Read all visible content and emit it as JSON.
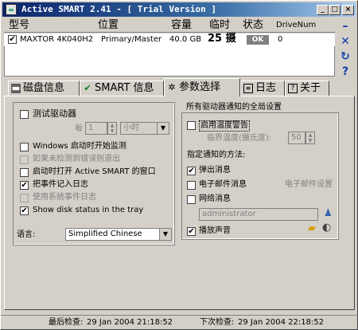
{
  "window": {
    "title": "Active SMART 2.41 - [ Trial Version ]"
  },
  "titlebar_buttons": {
    "minimize": "_",
    "maximize": "□",
    "close": "×"
  },
  "columns": {
    "model": "型号",
    "location": "位置",
    "capacity": "容量",
    "temp": "临时",
    "status": "状态",
    "drivenum": "DriveNum"
  },
  "drive": {
    "checked": "✔",
    "model": "MAXTOR 4K040H2",
    "location": "Primary/Master",
    "capacity": "40.0 GB",
    "temp": "25 摄",
    "status": "OK",
    "drivenum": "0"
  },
  "side_icons": {
    "minimize": "–",
    "close": "✕",
    "refresh": "↻",
    "help": "?"
  },
  "tabs": [
    {
      "label": "磁盘信息",
      "icon": "disk-icon"
    },
    {
      "label": "SMART 信息",
      "icon": "check-icon"
    },
    {
      "label": "参数选择",
      "icon": "gear-icon"
    },
    {
      "label": "日志",
      "icon": "log-icon"
    },
    {
      "label": "关于",
      "icon": "help-icon"
    }
  ],
  "left": {
    "test_drive": "测试驱动器",
    "every": "每",
    "every_value": "1",
    "every_unit": "小时",
    "windows_start": "Windows 启动时开始监测",
    "exit_if_none": "如果未检测到错误则退出",
    "open_window": "启动时打开 Active SMART 的窗口",
    "log_event": "把事件记入日志",
    "use_system_log": "使用系统事件日志",
    "show_tray": "Show disk status in the tray",
    "language_label": "语言:",
    "language_value": "Simplified Chinese",
    "check": "✔"
  },
  "right": {
    "group_title": "所有驱动器通知的全局设置",
    "enable_temp": "启用温度警告",
    "critical_temp": "临界温度(摄氏度):",
    "critical_value": "50",
    "notify_method": "指定通知的方法:",
    "popup": "弹出消息",
    "email": "电子邮件消息",
    "email_settings": "电子邮件设置",
    "net_message": "网络消息",
    "net_user": "administrator",
    "play_sound": "播放声音",
    "check": "✔"
  },
  "status": {
    "last_label": "最后检查:",
    "last_value": "29 Jan 2004  21:18:52",
    "next_label": "下次检查:",
    "next_value": "29 Jan 2004  22:18:52"
  },
  "colors": {
    "title_start": "#0a246a",
    "title_end": "#a6caf0",
    "face": "#d4d0c8",
    "accent_icon": "#1040b0"
  }
}
